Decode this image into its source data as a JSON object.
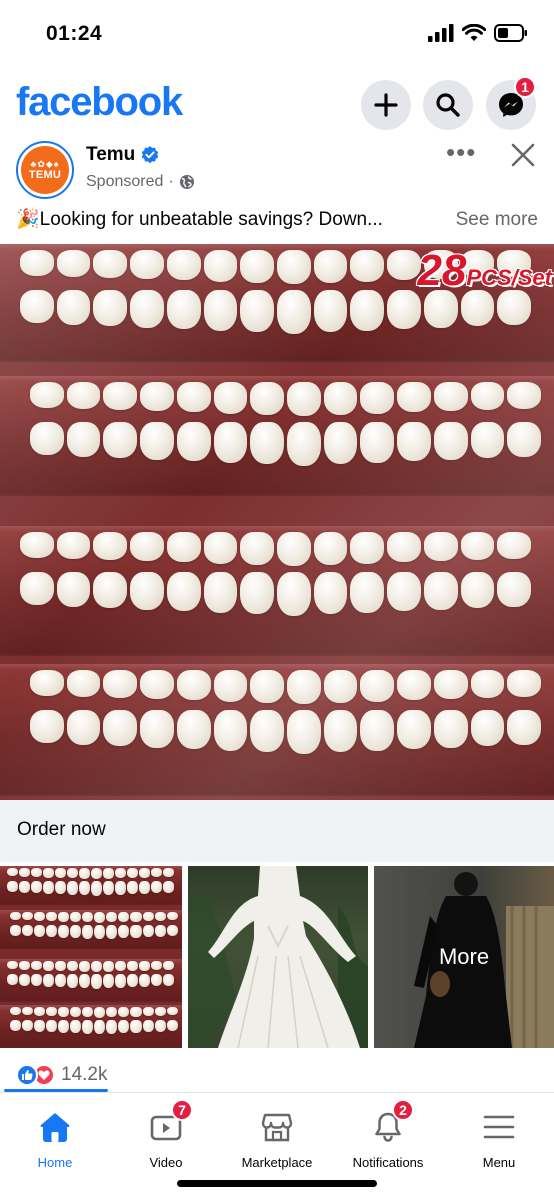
{
  "status_bar": {
    "time": "01:24"
  },
  "header": {
    "logo": "facebook",
    "messenger_badge": "1"
  },
  "post": {
    "page_name": "Temu",
    "avatar_text": "TEMU",
    "sponsored_label": "Sponsored",
    "separator": "·",
    "caption": "🎉Looking for unbeatable savings? Down...",
    "see_more": "See more",
    "image_promo": "28",
    "image_promo_suffix": "PCS/Set",
    "cta_label": "Order now",
    "carousel_more_label": "More",
    "reaction_count": "14.2k"
  },
  "bottom_nav": {
    "items": [
      {
        "label": "Home",
        "icon": "home-icon",
        "active": true
      },
      {
        "label": "Video",
        "icon": "video-icon",
        "badge": "7"
      },
      {
        "label": "Marketplace",
        "icon": "marketplace-icon"
      },
      {
        "label": "Notifications",
        "icon": "bell-icon",
        "badge": "2"
      },
      {
        "label": "Menu",
        "icon": "menu-icon"
      }
    ]
  },
  "colors": {
    "brand_blue": "#1877f2",
    "badge_red": "#e41e3f",
    "temu_orange": "#f26c1b",
    "secondary_text": "#65676b"
  }
}
